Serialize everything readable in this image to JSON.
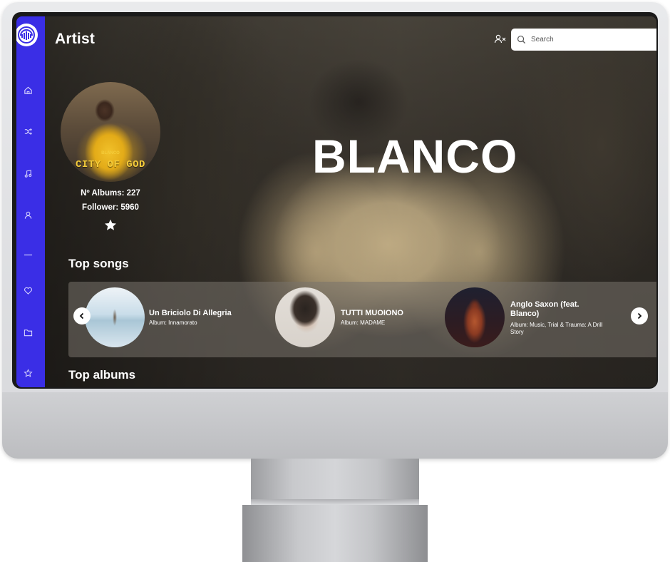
{
  "app": {
    "page_title": "Artist"
  },
  "search": {
    "placeholder": "Search"
  },
  "sidebar": {
    "items": [
      {
        "icon": "home-icon"
      },
      {
        "icon": "shuffle-icon"
      },
      {
        "icon": "music-note-icon"
      },
      {
        "icon": "user-icon"
      },
      {
        "icon": "divider"
      },
      {
        "icon": "heart-icon"
      },
      {
        "icon": "folder-icon"
      },
      {
        "icon": "star-icon"
      }
    ]
  },
  "artist": {
    "name": "BLANCO",
    "cover_label": "BLANCO",
    "cover_title": "CITY OF GOD",
    "albums": "Nº Albums: 227",
    "followers": "Follower: 5960"
  },
  "sections": {
    "top_songs": "Top songs",
    "top_albums": "Top albums"
  },
  "songs": [
    {
      "title": "Un Briciolo Di Allegria",
      "album": "Album: Innamorato"
    },
    {
      "title": "TUTTI MUOIONO",
      "album": "Album: MADAME"
    },
    {
      "title": "Anglo Saxon (feat. Blanco)",
      "album": "Album: Music, Trial & Trauma: A Drill Story"
    }
  ],
  "colors": {
    "sidebar": "#3a2ee6",
    "accent_yellow": "#f1c12a"
  }
}
